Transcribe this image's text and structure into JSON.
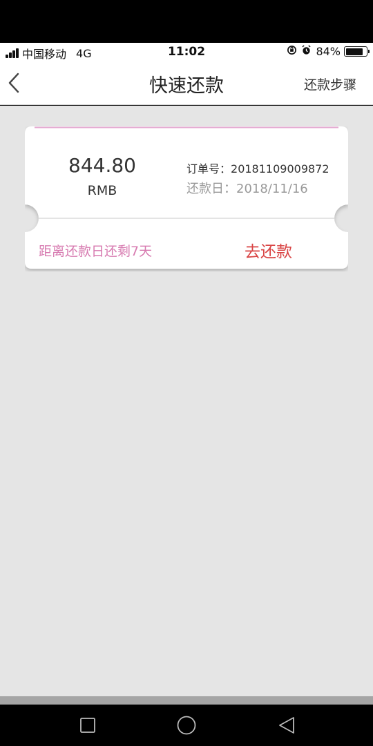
{
  "status_bar": {
    "carrier": "中国移动",
    "network": "4G",
    "time": "11:02",
    "battery": "84%",
    "battery_level": 0.84
  },
  "nav": {
    "title": "快速还款",
    "steps_label": "还款步骤"
  },
  "card": {
    "amount": "844.80",
    "currency": "RMB",
    "order_label": "订单号：",
    "order_no": "20181109009872",
    "due_label": "还款日：",
    "due_date": "2018/11/16",
    "remaining": "距离还款日还剩7天",
    "pay_label": "去还款"
  },
  "colors": {
    "accent_pink": "#e4a9d1",
    "pay_red": "#d94444",
    "remain_pink": "#d77ab0"
  }
}
